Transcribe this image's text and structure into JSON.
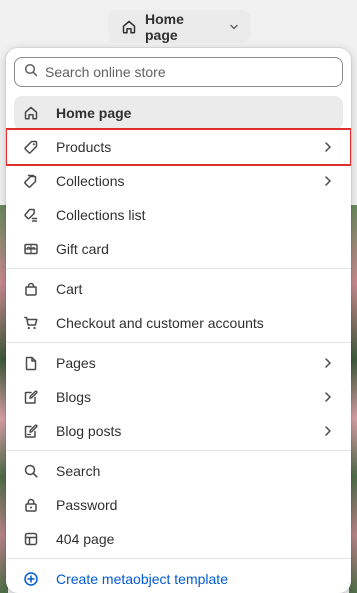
{
  "header": {
    "page_selector_label": "Home page"
  },
  "search": {
    "placeholder": "Search online store"
  },
  "menu": {
    "groups": [
      [
        {
          "label": "Home page",
          "icon": "home-icon",
          "has_submenu": false,
          "active": true
        },
        {
          "label": "Products",
          "icon": "tag-icon",
          "has_submenu": true,
          "highlighted": true
        },
        {
          "label": "Collections",
          "icon": "collection-icon",
          "has_submenu": true
        },
        {
          "label": "Collections list",
          "icon": "collection-list-icon",
          "has_submenu": false
        },
        {
          "label": "Gift card",
          "icon": "gift-card-icon",
          "has_submenu": false
        }
      ],
      [
        {
          "label": "Cart",
          "icon": "cart-bag-icon",
          "has_submenu": false
        },
        {
          "label": "Checkout and customer accounts",
          "icon": "cart-icon",
          "has_submenu": false
        }
      ],
      [
        {
          "label": "Pages",
          "icon": "page-icon",
          "has_submenu": true
        },
        {
          "label": "Blogs",
          "icon": "blog-icon",
          "has_submenu": true
        },
        {
          "label": "Blog posts",
          "icon": "blog-post-icon",
          "has_submenu": true
        }
      ],
      [
        {
          "label": "Search",
          "icon": "search-icon",
          "has_submenu": false
        },
        {
          "label": "Password",
          "icon": "lock-icon",
          "has_submenu": false
        },
        {
          "label": "404 page",
          "icon": "error-page-icon",
          "has_submenu": false
        }
      ],
      [
        {
          "label": "Create metaobject template",
          "icon": "plus-circle-icon",
          "has_submenu": false
        }
      ]
    ]
  },
  "colors": {
    "highlight_border": "#e02d2d",
    "link": "#005bd3",
    "active_bg": "#ebebeb"
  }
}
